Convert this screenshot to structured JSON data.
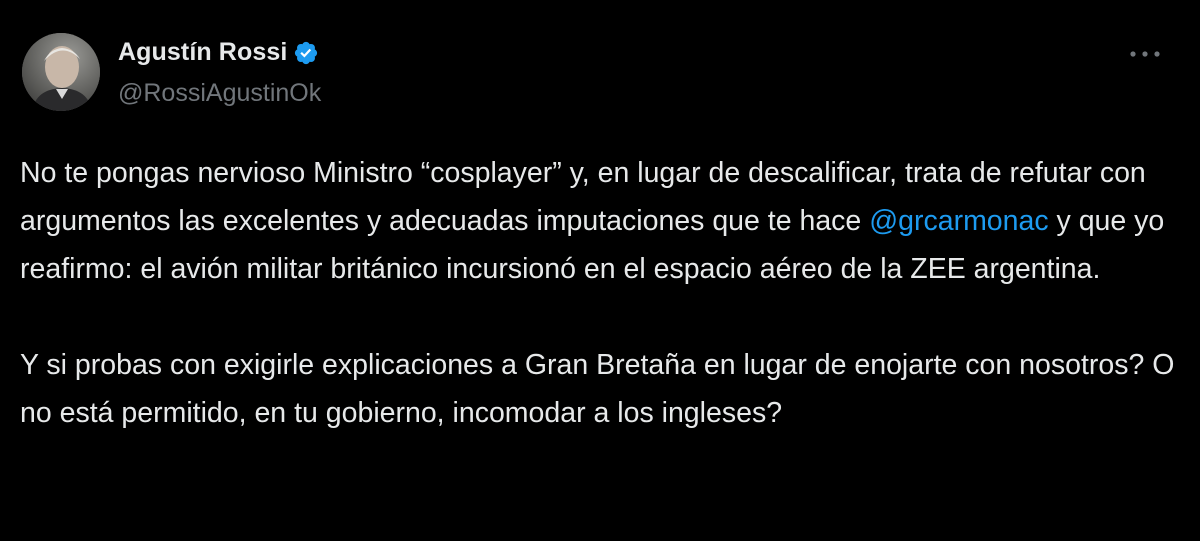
{
  "author": {
    "display_name": "Agustín Rossi",
    "handle": "@RossiAgustinOk",
    "verified": true,
    "avatar_icon": "profile-photo",
    "verified_icon": "verified-badge-icon",
    "verified_color": "#1d9bf0"
  },
  "more_button": {
    "icon": "more-horizontal-icon"
  },
  "tweet": {
    "paragraph1": {
      "before": "No te pongas nervioso Ministro “cosplayer” y, en lugar de descalificar, trata de refutar con argumentos las excelentes y adecuadas imputaciones que te hace ",
      "mention": "@grcarmonac",
      "after": " y que yo reafirmo: el avión militar británico incursionó en el espacio aéreo de la ZEE argentina."
    },
    "paragraph2": "Y si probas con exigirle explicaciones a Gran Bretaña en lugar de enojarte con nosotros? O no está permitido, en tu gobierno, incomodar a los ingleses?"
  },
  "colors": {
    "background": "#000000",
    "text": "#e7e9ea",
    "secondary": "#71767b",
    "link": "#1d9bf0"
  }
}
